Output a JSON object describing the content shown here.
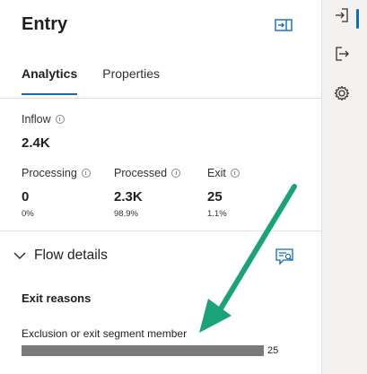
{
  "panel": {
    "title": "Entry",
    "tabs": [
      {
        "label": "Analytics",
        "active": true
      },
      {
        "label": "Properties",
        "active": false
      }
    ]
  },
  "metrics": {
    "inflow": {
      "label": "Inflow",
      "value": "2.4K"
    },
    "processing": {
      "label": "Processing",
      "value": "0",
      "percent": "0%"
    },
    "processed": {
      "label": "Processed",
      "value": "2.3K",
      "percent": "98.9%"
    },
    "exit": {
      "label": "Exit",
      "value": "25",
      "percent": "1.1%"
    }
  },
  "flow_details": {
    "title": "Flow details",
    "expanded": true,
    "exit_reasons": {
      "heading": "Exit reasons",
      "items": [
        {
          "label": "Exclusion or exit segment member",
          "count": "25",
          "fraction": 1.0
        }
      ]
    }
  },
  "icons": {
    "collapse": "collapse-panel-icon",
    "flow": "search-chat-icon",
    "rail": [
      "sign-in-icon",
      "sign-out-icon",
      "gear-icon"
    ]
  },
  "colors": {
    "accent": "#0f6cbd",
    "bar": "#7a7a7a",
    "annotation_arrow": "#1aa37a"
  }
}
